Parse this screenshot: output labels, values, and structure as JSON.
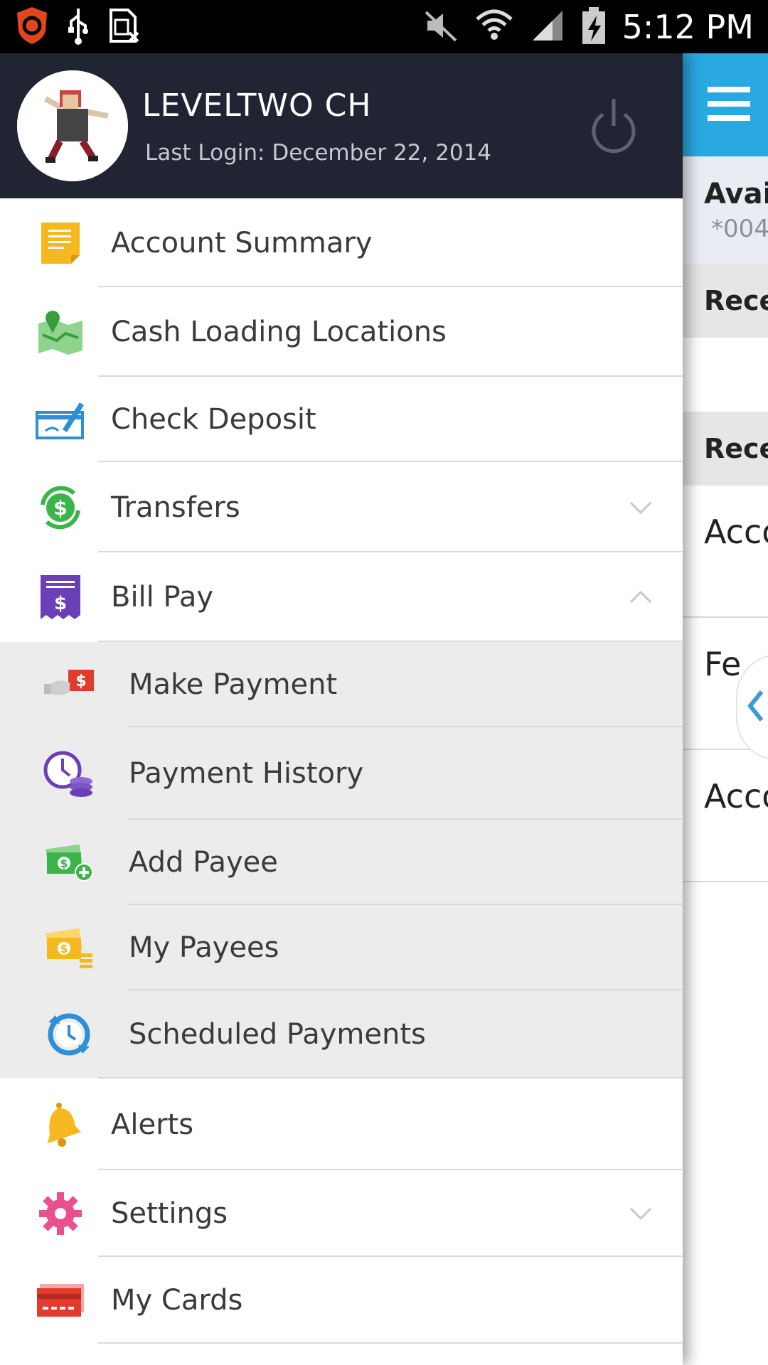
{
  "status_bar": {
    "time": "5:12 PM",
    "left_icons": [
      "shield-app-icon",
      "usb-icon",
      "sim-missing-icon"
    ],
    "right_icons": [
      "mute-icon",
      "wifi-icon",
      "signal-icon",
      "battery-charging-icon"
    ]
  },
  "profile": {
    "name": "LEVELTWO CH",
    "last_login": "Last Login: December 22, 2014"
  },
  "menu": {
    "items": [
      {
        "label": "Account Summary",
        "icon": "notepad-icon"
      },
      {
        "label": "Cash Loading Locations",
        "icon": "map-pin-icon"
      },
      {
        "label": "Check Deposit",
        "icon": "check-deposit-icon"
      },
      {
        "label": "Transfers",
        "icon": "transfer-dollar-icon",
        "expand": "collapsed"
      },
      {
        "label": "Bill Pay",
        "icon": "bill-receipt-icon",
        "expand": "expanded"
      },
      {
        "label": "Make Payment",
        "icon": "hand-dollar-icon",
        "sub": true
      },
      {
        "label": "Payment History",
        "icon": "clock-coins-icon",
        "sub": true
      },
      {
        "label": "Add Payee",
        "icon": "money-plus-icon",
        "sub": true
      },
      {
        "label": "My Payees",
        "icon": "money-stack-icon",
        "sub": true
      },
      {
        "label": "Scheduled Payments",
        "icon": "clock-refresh-icon",
        "sub": true
      },
      {
        "label": "Alerts",
        "icon": "bell-icon"
      },
      {
        "label": "Settings",
        "icon": "gear-icon",
        "expand": "collapsed"
      },
      {
        "label": "My Cards",
        "icon": "credit-card-icon"
      }
    ]
  },
  "background": {
    "balance_label": "Avai",
    "account_number": "*004",
    "section_1": "Rece",
    "section_2": "Rece",
    "rows": [
      "Acco",
      "Fe",
      "Acco"
    ]
  },
  "colors": {
    "header_dark": "#212432",
    "accent_blue": "#2aa8e0",
    "submenu_bg": "#ececec"
  }
}
